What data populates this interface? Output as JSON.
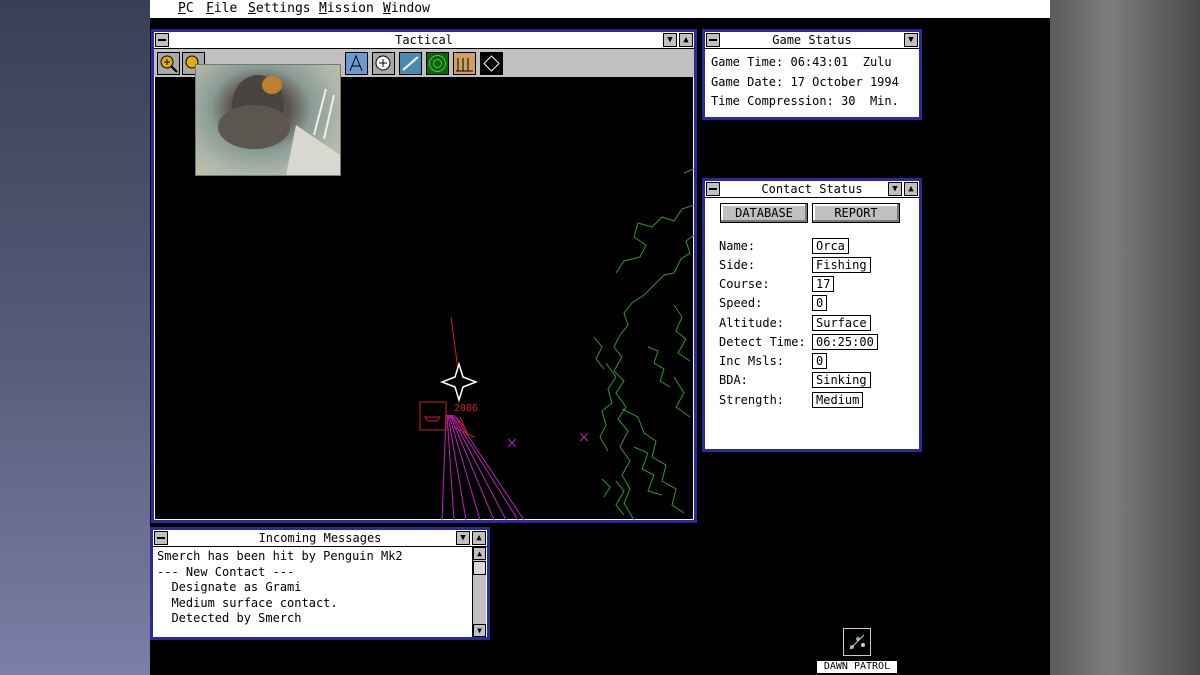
{
  "menu": [
    "PC",
    "File",
    "Settings",
    "Mission",
    "Window"
  ],
  "tactical": {
    "title": "Tactical",
    "tools": [
      "zoom-in-icon",
      "zoom-out-icon",
      "camera-icon",
      "waypoint-icon",
      "satellite-icon",
      "missile-icon",
      "radar-icon",
      "formation-icon",
      "navigate-icon"
    ],
    "contact_label": "2086"
  },
  "game_status": {
    "title": "Game Status",
    "rows": [
      {
        "label": "Game Time:",
        "value": "06:43:01  Zulu"
      },
      {
        "label": "Game Date:",
        "value": "17 October 1994"
      },
      {
        "label": "Time Compression:",
        "value": "30  Min."
      }
    ]
  },
  "contact_status": {
    "title": "Contact Status",
    "buttons": [
      "DATABASE",
      "REPORT"
    ],
    "fields": [
      {
        "label": "Name:",
        "value": "Orca"
      },
      {
        "label": "Side:",
        "value": "Fishing"
      },
      {
        "label": "Course:",
        "value": "17"
      },
      {
        "label": "Speed:",
        "value": "0"
      },
      {
        "label": "Altitude:",
        "value": "Surface"
      },
      {
        "label": "Detect Time:",
        "value": "06:25:00"
      },
      {
        "label": "Inc Msls:",
        "value": "0"
      },
      {
        "label": "BDA:",
        "value": "Sinking"
      },
      {
        "label": "Strength:",
        "value": "Medium"
      }
    ]
  },
  "messages": {
    "title": "Incoming Messages",
    "lines": [
      "Smerch has been hit by Penguin Mk2",
      "--- New Contact ---",
      "  Designate as Grami",
      "  Medium surface contact.",
      "  Detected by Smerch"
    ]
  },
  "desktop_icon": {
    "label": "DAWN PATROL",
    "icon": "dawn-patrol-icon"
  },
  "colors": {
    "frame": "#2a2aa0",
    "coast": "#2f9a2f",
    "missile_track": "#c020c0",
    "contact": "#d02020",
    "menu_bg": "#ffffff"
  }
}
